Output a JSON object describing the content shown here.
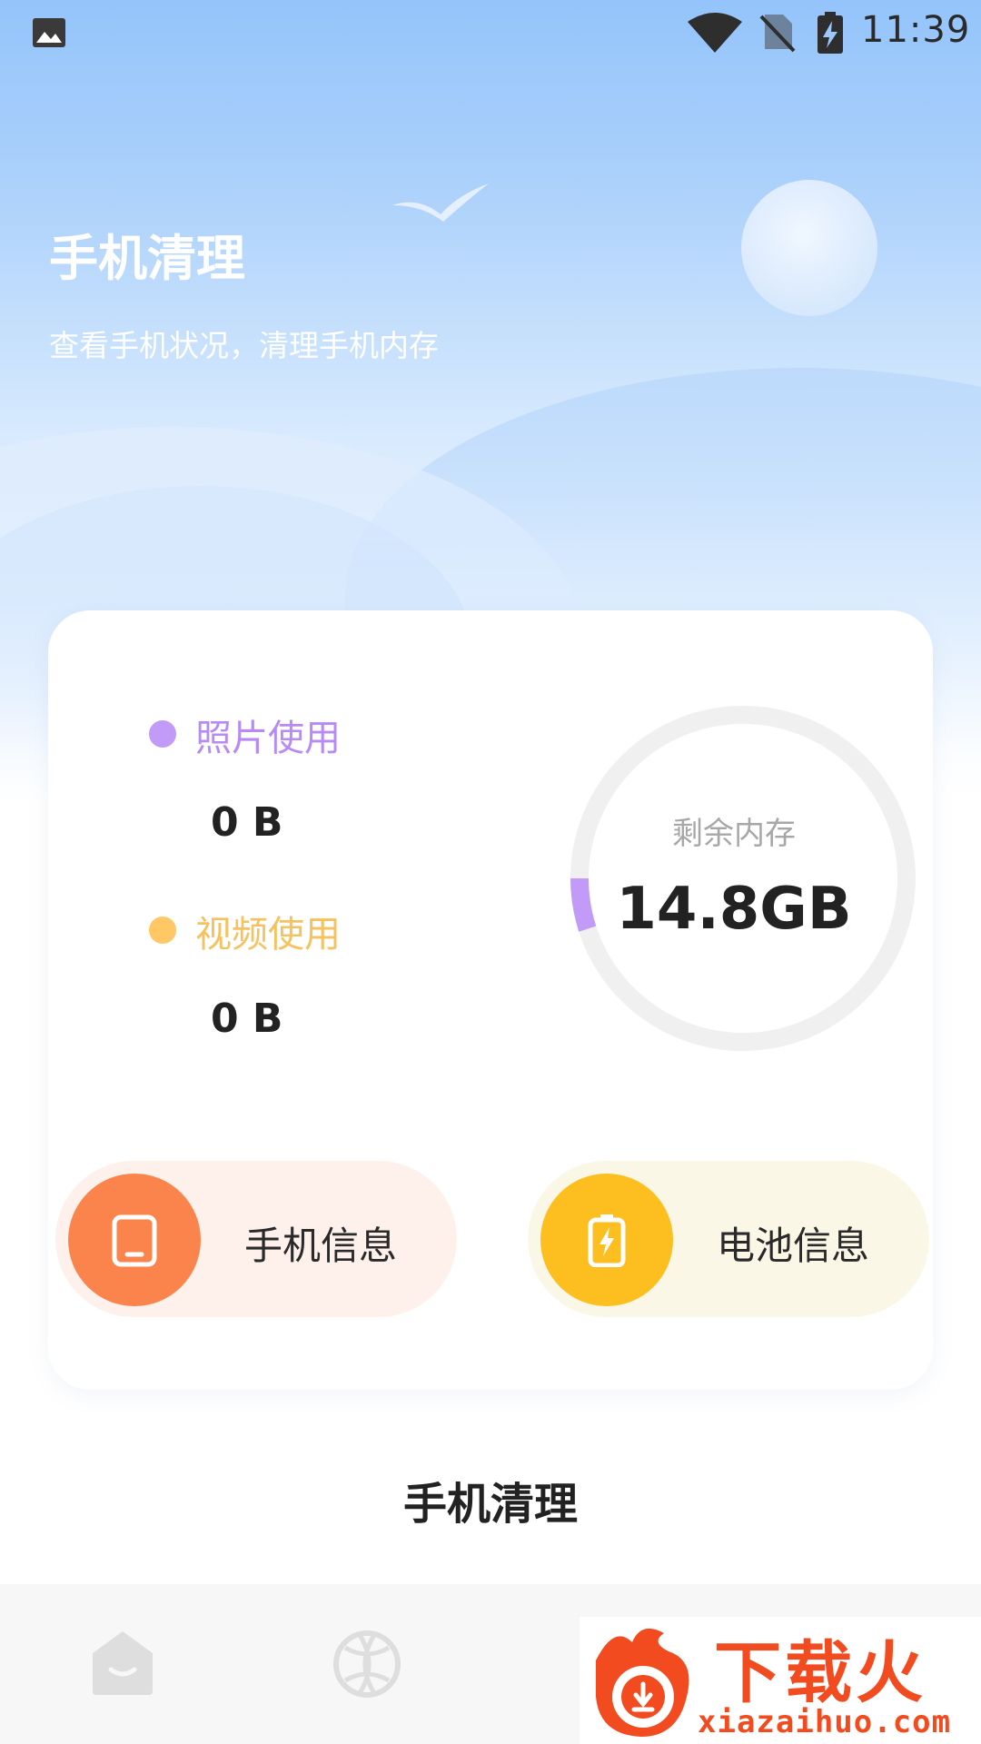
{
  "status_bar": {
    "time": "11:39",
    "icons": [
      "gallery-icon",
      "wifi-icon",
      "no-sim-icon",
      "battery-charging-icon"
    ]
  },
  "hero": {
    "title": "手机清理",
    "subtitle": "查看手机状况，清理手机内存"
  },
  "storage_card": {
    "photo": {
      "label": "照片使用",
      "value": "0 B",
      "color": "#c29bf8"
    },
    "video": {
      "label": "视频使用",
      "value": "0 B",
      "color": "#ffc865"
    },
    "ring": {
      "label": "剩余内存",
      "value": "14.8GB",
      "used_fraction": 0.05,
      "track_color": "#f0f0f0",
      "fill_color": "#c29bf8"
    },
    "buttons": [
      {
        "label": "手机信息",
        "icon": "phone-icon",
        "color": "#fb844c"
      },
      {
        "label": "电池信息",
        "icon": "battery-icon",
        "color": "#fdbf1f"
      }
    ]
  },
  "section": {
    "title": "手机清理"
  },
  "bottom_nav": {
    "items": [
      "home-icon",
      "globe-icon"
    ]
  },
  "watermark": {
    "text": "下载火",
    "domain": "xiazaihuo.com"
  }
}
